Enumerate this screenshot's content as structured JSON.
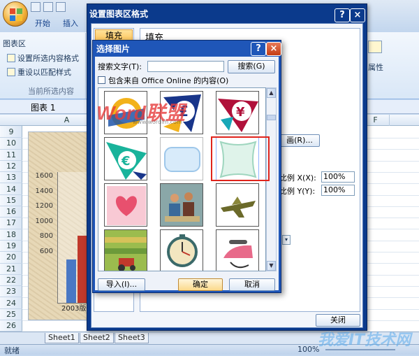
{
  "ribbon": {
    "tabs": [
      "开始",
      "插入"
    ],
    "group_title": "图表区",
    "items": [
      "设置所选内容格式",
      "重设以匹配样式"
    ],
    "group_label": "当前所选内容",
    "right_label": "属性"
  },
  "namebox": {
    "value": "图表 1"
  },
  "columns": [
    "A",
    "F"
  ],
  "rows": [
    "9",
    "10",
    "11",
    "12",
    "13",
    "14",
    "15",
    "16",
    "17",
    "18",
    "19",
    "20",
    "21",
    "22",
    "23",
    "24",
    "25",
    "26"
  ],
  "chart": {
    "yticks": [
      "1600",
      "1400",
      "1200",
      "1000",
      "800",
      "600"
    ],
    "category": "2003版",
    "series_colors": [
      "#4a78c4",
      "#c0392b"
    ]
  },
  "sheets": [
    "Sheet1",
    "Sheet2",
    "Sheet3"
  ],
  "status": {
    "ready": "就绪",
    "zoom": "100%"
  },
  "format_dialog": {
    "title": "设置图表区格式",
    "help": "?",
    "close": "×",
    "nav_selected": "填充",
    "heading": "填充",
    "picture_button": "画(R)...",
    "scale_x_label": "比例 X(X):",
    "scale_x_value": "100%",
    "scale_y_label": "比例 Y(Y):",
    "scale_y_value": "100%",
    "close_button": "关闭"
  },
  "picture_dialog": {
    "title": "选择图片",
    "help": "?",
    "close": "×",
    "search_label": "搜索文字(T):",
    "search_value": "",
    "search_button": "搜索(G)",
    "online_label": "包含来自 Office Online 的内容(O)",
    "import_button": "导入(I)...",
    "ok_button": "确定",
    "cancel_button": "取消",
    "thumbnails": [
      {
        "name": "coin-clipart"
      },
      {
        "name": "pound-clipart"
      },
      {
        "name": "yen-clipart"
      },
      {
        "name": "euro-clipart"
      },
      {
        "name": "blue-frame-clipart"
      },
      {
        "name": "green-frame-clipart"
      },
      {
        "name": "heart-clipart"
      },
      {
        "name": "people-clipart"
      },
      {
        "name": "airplane-clipart"
      },
      {
        "name": "farm-clipart"
      },
      {
        "name": "clock-clipart"
      },
      {
        "name": "iron-clipart"
      }
    ]
  },
  "watermark": {
    "logo_word": "Word",
    "logo_cn": "联盟",
    "url": "www.wordlm.com",
    "site": "我爱IT技术网"
  }
}
